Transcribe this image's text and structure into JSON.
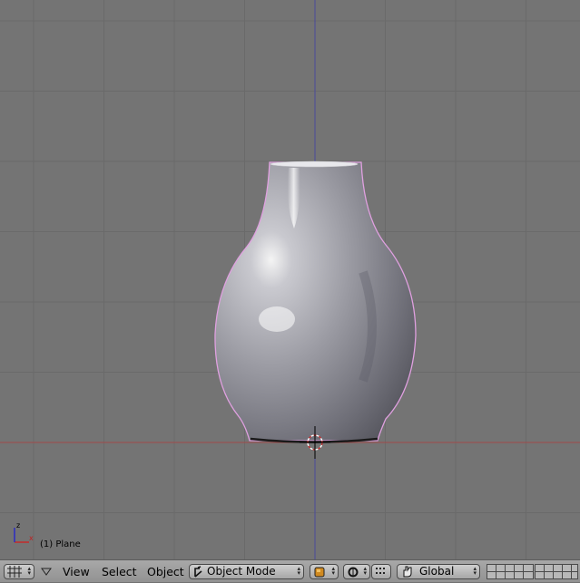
{
  "viewport": {
    "object_label": "(1) Plane",
    "gizmo": {
      "z_label": "z",
      "x_label": "x"
    },
    "colors": {
      "background": "#747474",
      "grid": "#6a6a6a",
      "x_axis": "#a04a4a",
      "z_axis": "#4a4a9a",
      "selection_outline": "#e0a0e0"
    }
  },
  "header": {
    "view_menu": "View",
    "select_menu": "Select",
    "object_menu": "Object",
    "mode_select": "Object Mode",
    "orientation_select": "Global",
    "icons": {
      "editor_type": "grid-icon",
      "menu_toggle": "triangle-down-icon",
      "mode": "object-mode-icon",
      "shading": "solid-shading-icon",
      "pivot": "pivot-icon",
      "manipulator": "hand-icon"
    }
  }
}
